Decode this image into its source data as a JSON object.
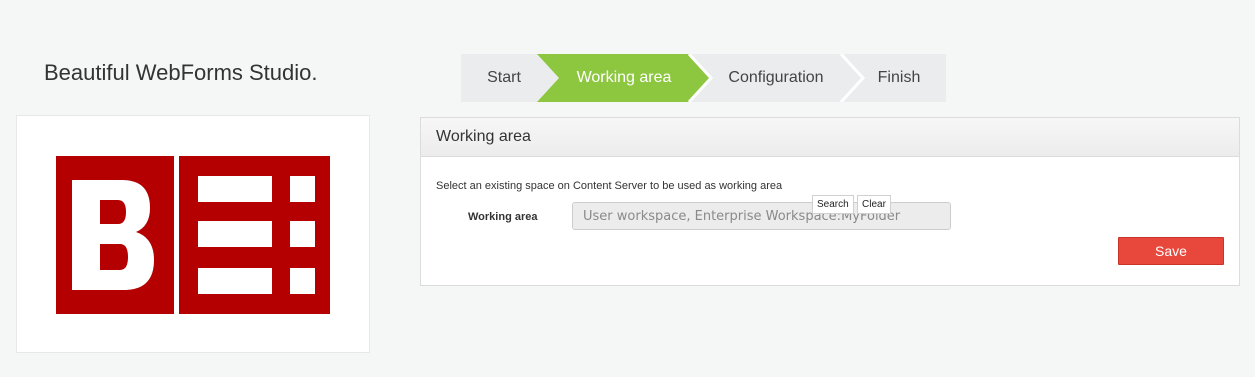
{
  "app": {
    "title": "Beautiful WebForms Studio."
  },
  "wizard": {
    "steps": [
      {
        "label": "Start",
        "active": false
      },
      {
        "label": "Working area",
        "active": true
      },
      {
        "label": "Configuration",
        "active": false
      },
      {
        "label": "Finish",
        "active": false
      }
    ]
  },
  "panel": {
    "title": "Working area",
    "hint": "Select an existing space on Content Server to be used as working area",
    "field_label": "Working area",
    "field_placeholder": "User workspace, Enterprise Workspace:MyFolder",
    "search_label": "Search",
    "clear_label": "Clear",
    "save_label": "Save"
  },
  "colors": {
    "accent_green": "#8dc63f",
    "step_bg": "#ebeced",
    "save_red": "#e8473b",
    "logo_red": "#b40000"
  }
}
